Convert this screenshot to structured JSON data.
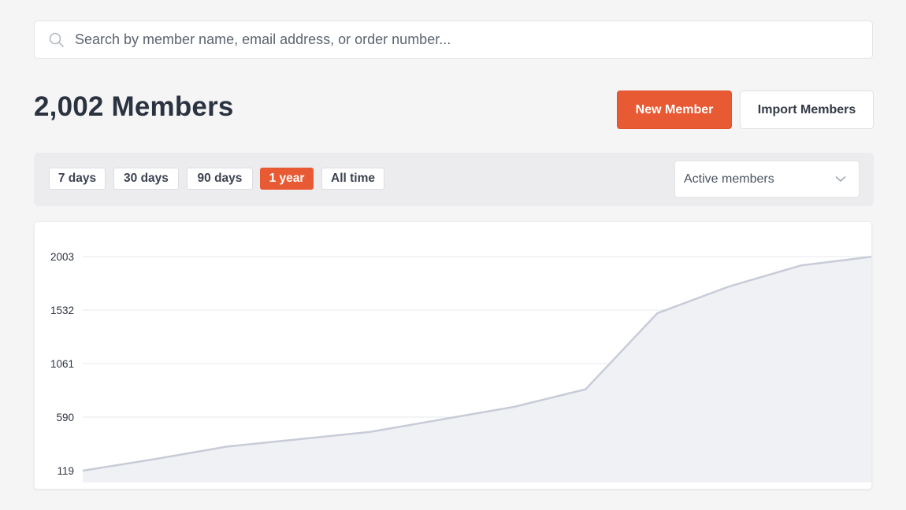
{
  "search": {
    "placeholder": "Search by member name, email address, or order number..."
  },
  "header": {
    "title": "2,002 Members",
    "new_member_label": "New Member",
    "import_members_label": "Import Members"
  },
  "filters": {
    "ranges": [
      "7 days",
      "30 days",
      "90 days",
      "1 year",
      "All time"
    ],
    "active_range": "1 year",
    "metric_select": "Active members"
  },
  "colors": {
    "accent": "#e85a34",
    "line": "#c8ccd8",
    "area": "#f0f1f5"
  },
  "chart_data": {
    "type": "area",
    "title": "",
    "xlabel": "",
    "ylabel": "",
    "y_ticks": [
      119,
      590,
      1061,
      1532,
      2003
    ],
    "ylim": [
      119,
      2003
    ],
    "grid": true,
    "series": [
      {
        "values": [
          119,
          220,
          330,
          395,
          460,
          570,
          680,
          835,
          1505,
          1740,
          1925,
          2003
        ]
      }
    ]
  }
}
